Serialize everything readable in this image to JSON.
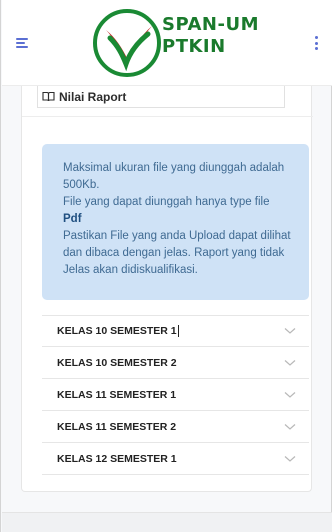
{
  "header": {
    "brand_line1": "SPAN-UM",
    "brand_line2": "PTKIN",
    "menu_icon": "hamburger-icon",
    "more_icon": "kebab-menu-icon",
    "logo_icon": "span-um-ptkin-logo"
  },
  "tab": {
    "label": "Nilai Raport",
    "icon": "book-icon"
  },
  "alert": {
    "line1": "Maksimal ukuran file yang diunggah adalah 500Kb.",
    "line2": "File yang dapat diunggah hanya type file",
    "line3": "Pdf",
    "line4": "Pastikan File yang anda Upload dapat dilihat dan dibaca dengan jelas. Raport yang tidak Jelas akan didiskualifikasi."
  },
  "semesters": [
    {
      "label": "KELAS 10 SEMESTER 1"
    },
    {
      "label": "KELAS 10 SEMESTER 2"
    },
    {
      "label": "KELAS 11 SEMESTER 1"
    },
    {
      "label": "KELAS 11 SEMESTER 2"
    },
    {
      "label": "KELAS 12 SEMESTER 1"
    }
  ],
  "colors": {
    "brand_green": "#1a7a2c",
    "accent": "#5b6fd3",
    "alert_bg": "#cfe2f6",
    "alert_text": "#3f6a92"
  }
}
